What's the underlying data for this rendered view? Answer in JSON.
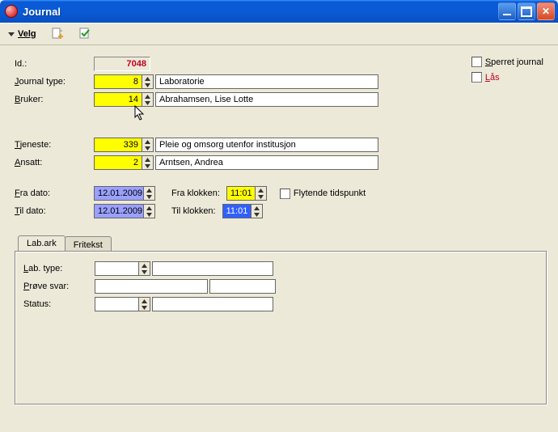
{
  "window": {
    "title": "Journal"
  },
  "toolbar": {
    "menu_label": "Velg"
  },
  "id_label": "Id.:",
  "id_value": "7048",
  "journal_type_label_pre": "J",
  "journal_type_label_rest": "ournal type:",
  "journal_type_value": "8",
  "journal_type_desc": "Laboratorie",
  "bruker_label_pre": "B",
  "bruker_label_rest": "ruker:",
  "bruker_value": "14",
  "bruker_desc": "Abrahamsen, Lise Lotte",
  "tjeneste_label_pre": "T",
  "tjeneste_label_rest": "jeneste:",
  "tjeneste_value": "339",
  "tjeneste_desc": "Pleie og omsorg utenfor institusjon",
  "ansatt_label_pre": "A",
  "ansatt_label_rest": "nsatt:",
  "ansatt_value": "2",
  "ansatt_desc": "Arntsen, Andrea",
  "fra_dato_label_pre": "F",
  "fra_dato_label_rest": "ra dato:",
  "fra_dato_value": "12.01.2009",
  "fra_klokken_label": "Fra klokken:",
  "fra_klokken_value": "11:01",
  "flytende_label": "Flytende tidspunkt",
  "til_dato_label_pre": "T",
  "til_dato_label_rest": "il dato:",
  "til_dato_value": "12.01.2009",
  "til_klokken_label": "Til klokken:",
  "til_klokken_value": "11:01",
  "sperret_label_pre": "S",
  "sperret_label_rest": "perret journal",
  "las_label_pre": "L",
  "las_label_rest": "ås",
  "tabs": {
    "labark": "Lab.ark",
    "fritekst": "Fritekst"
  },
  "lab_type_label_pre": "L",
  "lab_type_label_rest": "ab. type:",
  "prove_svar_label_pre": "P",
  "prove_svar_label_rest": "røve svar:",
  "status_label_pre": "",
  "status_label_rest": "Status:"
}
